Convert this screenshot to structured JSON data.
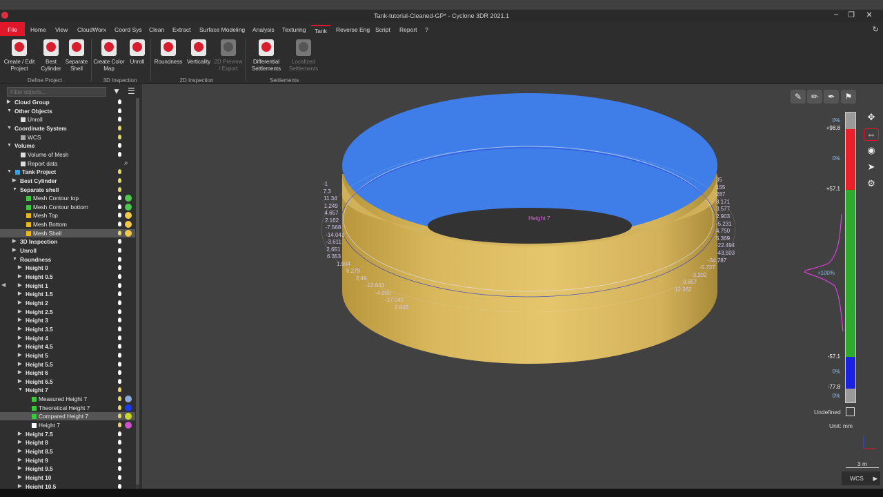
{
  "window": {
    "title": "Tank-tutorial-Cleaned-GP* - Cyclone 3DR 2021.1"
  },
  "menu": {
    "items": [
      "File",
      "Home",
      "View",
      "CloudWorx",
      "Coord Sys",
      "Clean",
      "Extract",
      "Surface Modeling",
      "Analysis",
      "Texturing",
      "Tank",
      "Reverse Eng",
      "Script",
      "Report",
      "?"
    ],
    "active": "Tank"
  },
  "ribbon": {
    "buttons": [
      {
        "label": "Create / Edit Project",
        "enabled": true
      },
      {
        "label": "Best Cylinder",
        "enabled": true
      },
      {
        "label": "Separate Shell",
        "enabled": true
      },
      {
        "label": "Create Color Map",
        "enabled": true
      },
      {
        "label": "Unroll",
        "enabled": true
      },
      {
        "label": "Roundness",
        "enabled": true
      },
      {
        "label": "Verticality",
        "enabled": true
      },
      {
        "label": "2D Preview / Export",
        "enabled": false
      },
      {
        "label": "Differential Settlements",
        "enabled": true
      },
      {
        "label": "Localized Settlements",
        "enabled": false
      }
    ],
    "groups": [
      "Define Project",
      "3D Inspection",
      "2D Inspection",
      "Settlements"
    ]
  },
  "panel": {
    "filter_placeholder": "Filter objects...",
    "tree": [
      {
        "label": "Cloud Group",
        "level": 0,
        "bold": true,
        "arrow": "right",
        "bulb": "white"
      },
      {
        "label": "Other Objects",
        "level": 0,
        "bold": true,
        "arrow": "down",
        "bulb": "white"
      },
      {
        "label": "Unroll",
        "level": 1,
        "bold": false,
        "arrow": "",
        "bulb": "white",
        "icon": "unroll"
      },
      {
        "label": "Coordinate System",
        "level": 0,
        "bold": true,
        "arrow": "down",
        "bulb": "yellow"
      },
      {
        "label": "WCS",
        "level": 1,
        "bold": false,
        "arrow": "",
        "bulb": "yellow",
        "icon": "wcs"
      },
      {
        "label": "Volume",
        "level": 0,
        "bold": true,
        "arrow": "down",
        "bulb": "white"
      },
      {
        "label": "Volume of Mesh",
        "level": 1,
        "bold": false,
        "arrow": "",
        "bulb": "white",
        "icon": "volume"
      },
      {
        "label": "Report data",
        "level": 1,
        "bold": false,
        "arrow": "",
        "bulb": "none",
        "icon": "report"
      },
      {
        "label": "Tank Project",
        "level": 0,
        "bold": true,
        "arrow": "down",
        "bulb": "yellow",
        "icon": "tank"
      },
      {
        "label": "Best Cylinder",
        "level": 1,
        "bold": true,
        "arrow": "right",
        "bulb": "yellow"
      },
      {
        "label": "Separate shell",
        "level": 1,
        "bold": true,
        "arrow": "down",
        "bulb": "yellow"
      },
      {
        "label": "Mesh Contour top",
        "level": 2,
        "bold": false,
        "arrow": "",
        "bulb": "white",
        "icon": "polyline",
        "dot": "#4ec94e"
      },
      {
        "label": "Mesh Contour bottom",
        "level": 2,
        "bold": false,
        "arrow": "",
        "bulb": "white",
        "icon": "polyline",
        "dot": "#4ec94e"
      },
      {
        "label": "Mesh Top",
        "level": 2,
        "bold": false,
        "arrow": "",
        "bulb": "white",
        "icon": "mesh",
        "dot": "#f0c84a"
      },
      {
        "label": "Mesh Bottom",
        "level": 2,
        "bold": false,
        "arrow": "",
        "bulb": "white",
        "icon": "mesh",
        "dot": "#f0c84a"
      },
      {
        "label": "Mesh Shell",
        "level": 2,
        "bold": false,
        "arrow": "",
        "bulb": "yellow",
        "icon": "mesh",
        "dot": "#f0c84a",
        "selected": true
      },
      {
        "label": "3D Inspection",
        "level": 1,
        "bold": true,
        "arrow": "right",
        "bulb": "white"
      },
      {
        "label": "Unroll",
        "level": 1,
        "bold": true,
        "arrow": "right",
        "bulb": "white"
      },
      {
        "label": "Roundness",
        "level": 1,
        "bold": true,
        "arrow": "down",
        "bulb": "white"
      },
      {
        "label": "Height 0",
        "level": 2,
        "bold": true,
        "arrow": "right",
        "bulb": "white"
      },
      {
        "label": "Height 0.5",
        "level": 2,
        "bold": true,
        "arrow": "right",
        "bulb": "white"
      },
      {
        "label": "Height 1",
        "level": 2,
        "bold": true,
        "arrow": "right",
        "bulb": "white"
      },
      {
        "label": "Height 1.5",
        "level": 2,
        "bold": true,
        "arrow": "right",
        "bulb": "white"
      },
      {
        "label": "Height 2",
        "level": 2,
        "bold": true,
        "arrow": "right",
        "bulb": "white"
      },
      {
        "label": "Height 2.5",
        "level": 2,
        "bold": true,
        "arrow": "right",
        "bulb": "white"
      },
      {
        "label": "Height 3",
        "level": 2,
        "bold": true,
        "arrow": "right",
        "bulb": "white"
      },
      {
        "label": "Height 3.5",
        "level": 2,
        "bold": true,
        "arrow": "right",
        "bulb": "white"
      },
      {
        "label": "Height 4",
        "level": 2,
        "bold": true,
        "arrow": "right",
        "bulb": "white"
      },
      {
        "label": "Height 4.5",
        "level": 2,
        "bold": true,
        "arrow": "right",
        "bulb": "white"
      },
      {
        "label": "Height 5",
        "level": 2,
        "bold": true,
        "arrow": "right",
        "bulb": "white"
      },
      {
        "label": "Height 5.5",
        "level": 2,
        "bold": true,
        "arrow": "right",
        "bulb": "white"
      },
      {
        "label": "Height 6",
        "level": 2,
        "bold": true,
        "arrow": "right",
        "bulb": "white"
      },
      {
        "label": "Height 6.5",
        "level": 2,
        "bold": true,
        "arrow": "right",
        "bulb": "white"
      },
      {
        "label": "Height 7",
        "level": 2,
        "bold": true,
        "arrow": "down",
        "bulb": "yellow"
      },
      {
        "label": "Measured Height 7",
        "level": 3,
        "bold": false,
        "arrow": "",
        "bulb": "yellow",
        "icon": "polyline",
        "dot": "#8fa8d8"
      },
      {
        "label": "Theoretical Height 7",
        "level": 3,
        "bold": false,
        "arrow": "",
        "bulb": "yellow",
        "icon": "polyline",
        "dot": "#1a3cf0"
      },
      {
        "label": "Compared Height 7",
        "level": 3,
        "bold": false,
        "arrow": "",
        "bulb": "yellow",
        "icon": "polyline",
        "dot": "#c8d82a",
        "selected": true
      },
      {
        "label": "Height 7",
        "level": 3,
        "bold": false,
        "arrow": "",
        "bulb": "yellow",
        "icon": "point",
        "dot": "#d050d0"
      },
      {
        "label": "Height 7.5",
        "level": 2,
        "bold": true,
        "arrow": "right",
        "bulb": "white"
      },
      {
        "label": "Height 8",
        "level": 2,
        "bold": true,
        "arrow": "right",
        "bulb": "white"
      },
      {
        "label": "Height 8.5",
        "level": 2,
        "bold": true,
        "arrow": "right",
        "bulb": "white"
      },
      {
        "label": "Height 9",
        "level": 2,
        "bold": true,
        "arrow": "right",
        "bulb": "white"
      },
      {
        "label": "Height 9.5",
        "level": 2,
        "bold": true,
        "arrow": "right",
        "bulb": "white"
      },
      {
        "label": "Height 10",
        "level": 2,
        "bold": true,
        "arrow": "right",
        "bulb": "white"
      },
      {
        "label": "Height 10.5",
        "level": 2,
        "bold": true,
        "arrow": "right",
        "bulb": "white"
      }
    ]
  },
  "colors": {
    "accent": "#e0162b",
    "top_surface": "#3f7ee8",
    "shell": "#d7b75c",
    "scale_red": "#e8202a",
    "scale_green": "#2eaa2e",
    "scale_blue": "#1a22e0",
    "histogram": "#e040e0"
  },
  "scale": {
    "top_pct": "0%",
    "max": "+98.8",
    "top2_pct": "0%",
    "upper": "+57.1",
    "center_pct": "+100%",
    "lower": "-57.1",
    "bottom_pct": "0%",
    "min": "-77.8",
    "bottom2_pct": "0%",
    "undefined_label": "Undefined",
    "unit_label": "Unit: mm"
  },
  "viewport": {
    "height_marker": "Height 7",
    "left_labels": [
      "-1",
      "7.3",
      "11.34",
      "1.249",
      "4.657",
      "2.162",
      "-7.568",
      "-14.041",
      "-3.611",
      "2.651",
      "6.353",
      "1.904",
      "6.279",
      "2.49",
      "-12.643",
      "-4.033",
      "-17.049",
      "2.848"
    ],
    "right_labels": [
      "35",
      "155",
      "287",
      "8.171",
      "3.577",
      "2.903",
      "-5.231",
      "4.750",
      "5.369",
      "-22.494",
      "-43.503",
      "-34.787",
      "-5.727",
      "-3.202",
      "0.657",
      "12.362"
    ],
    "scale_bar": "3 m",
    "coord_system": "WCS"
  }
}
